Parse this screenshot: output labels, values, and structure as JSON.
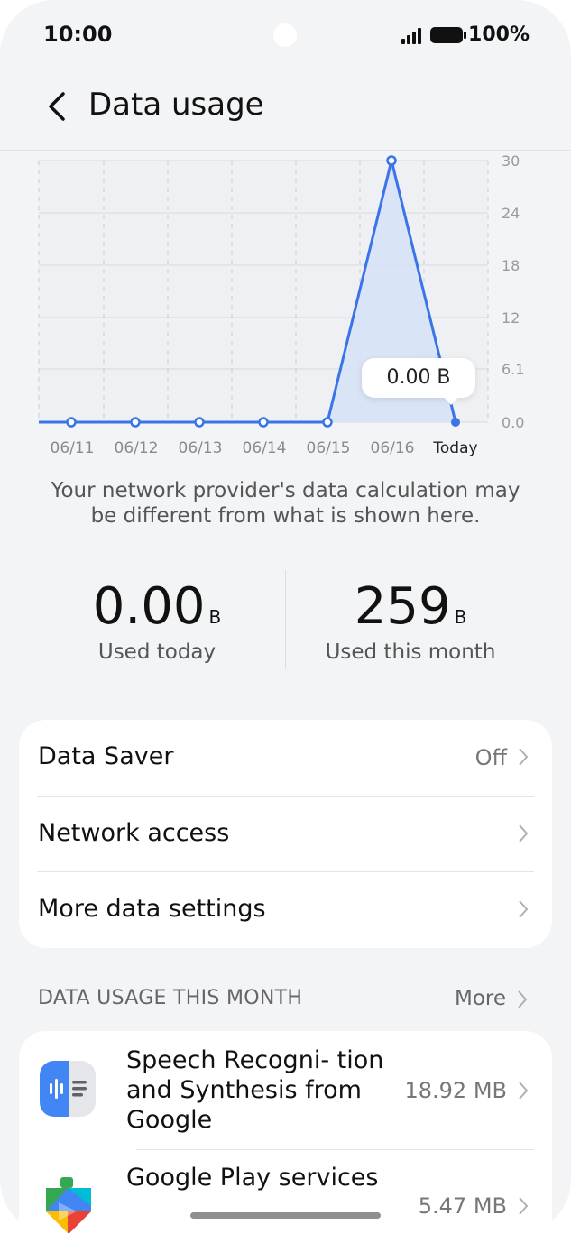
{
  "status_bar": {
    "time": "10:00",
    "battery_percent": "100%",
    "signal_bars": 4
  },
  "header": {
    "back_icon": "chevron-left-icon",
    "title": "Data usage"
  },
  "chart_data": {
    "type": "line",
    "categories": [
      "06/11",
      "06/12",
      "06/13",
      "06/14",
      "06/15",
      "06/16",
      "Today"
    ],
    "series": [
      {
        "values": [
          0,
          0,
          0,
          0,
          0,
          30,
          0
        ]
      }
    ],
    "y_ticks": [
      "30",
      "24",
      "18",
      "12",
      "6.1",
      "0.0"
    ],
    "ylim": [
      0,
      30
    ],
    "grid": true,
    "area_fill": true,
    "line_color": "#3a74e8",
    "fill_color": "#d6e2f7",
    "highlight_label": "0.00 B",
    "highlight_index": 6
  },
  "note": "Your network provider's data calculation may be different from what is shown here.",
  "stats": {
    "today": {
      "value": "0.00",
      "unit": "B",
      "label": "Used today"
    },
    "month": {
      "value": "259",
      "unit": "B",
      "label": "Used this month"
    }
  },
  "settings": {
    "data_saver": {
      "label": "Data Saver",
      "value": "Off"
    },
    "network_access": {
      "label": "Network access"
    },
    "more_data_settings": {
      "label": "More data settings"
    }
  },
  "usage_section": {
    "title": "DATA USAGE THIS MONTH",
    "more_label": "More",
    "apps": [
      {
        "name": "Speech Recogni- tion and Synthesis from Google",
        "size": "18.92 MB",
        "icon": "speech-services-icon"
      },
      {
        "name": "Google Play services",
        "size": "5.47 MB",
        "icon": "google-play-services-icon"
      }
    ]
  },
  "colors": {
    "background": "#f3f4f6",
    "card": "#ffffff",
    "accent": "#3a74e8"
  }
}
